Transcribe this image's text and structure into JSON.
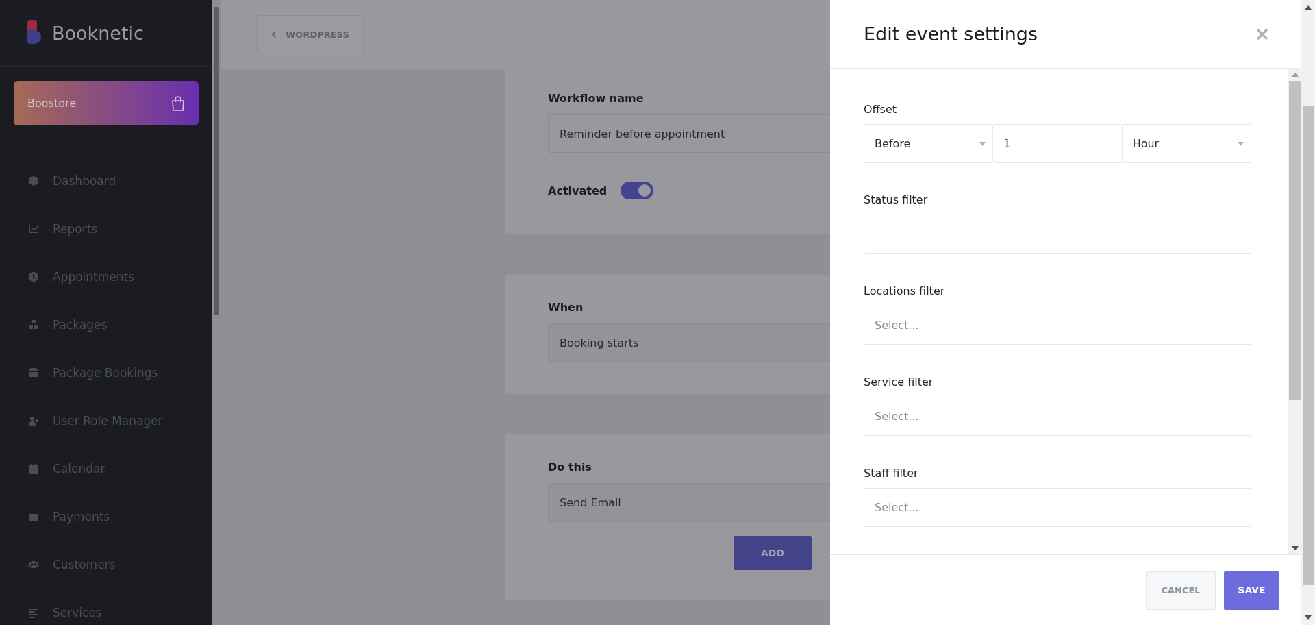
{
  "sidebar": {
    "brand": "Booknetic",
    "store_button": "Boostore",
    "items": [
      {
        "label": "Dashboard"
      },
      {
        "label": "Reports"
      },
      {
        "label": "Appointments"
      },
      {
        "label": "Packages"
      },
      {
        "label": "Package Bookings"
      },
      {
        "label": "User Role Manager"
      },
      {
        "label": "Calendar"
      },
      {
        "label": "Payments"
      },
      {
        "label": "Customers"
      },
      {
        "label": "Services"
      }
    ]
  },
  "main": {
    "back_button": "WORDPRESS",
    "workflow": {
      "label": "Workflow name",
      "value": "Reminder before appointment",
      "toggle_label": "Activated",
      "activated": true
    },
    "when": {
      "label": "When",
      "value": "Booking starts"
    },
    "do_this": {
      "label": "Do this",
      "value": "Send Email",
      "add_button": "ADD"
    }
  },
  "panel": {
    "title": "Edit event settings",
    "offset": {
      "label": "Offset",
      "direction": "Before",
      "amount": "1",
      "unit": "Hour"
    },
    "fields": [
      {
        "label": "Status filter"
      },
      {
        "label": "Locations filter",
        "placeholder": "Select..."
      },
      {
        "label": "Service filter",
        "placeholder": "Select..."
      },
      {
        "label": "Staff filter",
        "placeholder": "Select..."
      }
    ],
    "buttons": {
      "cancel": "CANCEL",
      "save": "SAVE"
    }
  }
}
